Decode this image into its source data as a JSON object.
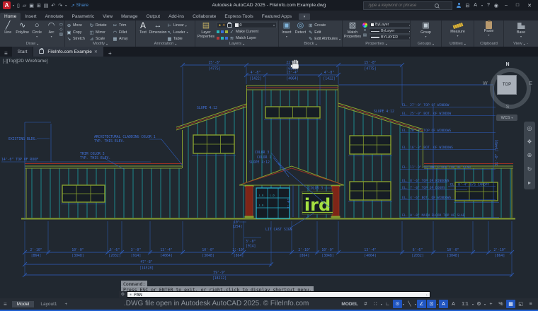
{
  "ui": {
    "caret": "▾",
    "close": "✕",
    "plus": "+",
    "hamburger": "≡",
    "min": "–",
    "max": "□",
    "collapse": "⌃",
    "slash": "╱"
  },
  "titlebar": {
    "logo": "A",
    "qat": [
      {
        "name": "new-icon",
        "glyph": "▯"
      },
      {
        "name": "open-icon",
        "glyph": "▱"
      },
      {
        "name": "save-icon",
        "glyph": "▣"
      },
      {
        "name": "saveas-icon",
        "glyph": "⊞"
      },
      {
        "name": "plot-icon",
        "glyph": "▤"
      },
      {
        "name": "undo-icon",
        "glyph": "↶"
      },
      {
        "name": "redo-icon",
        "glyph": "↷"
      }
    ],
    "share_icon": "↗",
    "share_label": "Share",
    "title": "Autodesk AutoCAD 2025 - FileInfo.com Example.dwg",
    "search_placeholder": "Type a keyword or phrase",
    "cart_icon": "⊟",
    "autodesk_icon": "A",
    "help_icon": "?",
    "account_icon": "◉"
  },
  "ribbon": {
    "tabs": [
      "Home",
      "Insert",
      "Annotate",
      "Parametric",
      "View",
      "Manage",
      "Output",
      "Add-ins",
      "Collaborate",
      "Express Tools",
      "Featured Apps"
    ],
    "draw": {
      "label": "Draw",
      "tools": [
        {
          "label": "Line",
          "glyph": "╱"
        },
        {
          "label": "Polyline",
          "glyph": "∿"
        },
        {
          "label": "Circle",
          "glyph": "○"
        },
        {
          "label": "Arc",
          "glyph": "◠"
        }
      ],
      "extras": [
        "▭",
        "◇",
        "▨"
      ]
    },
    "modify": {
      "label": "Modify",
      "tools": [
        {
          "label": "Move",
          "glyph": "⊕"
        },
        {
          "label": "Rotate",
          "glyph": "↻"
        },
        {
          "label": "Trim",
          "glyph": "✂"
        },
        {
          "label": "Copy",
          "glyph": "▣"
        },
        {
          "label": "Mirror",
          "glyph": "◫"
        },
        {
          "label": "Fillet",
          "glyph": "◠"
        },
        {
          "label": "Stretch",
          "glyph": "↘"
        },
        {
          "label": "Scale",
          "glyph": "⊿"
        },
        {
          "label": "Array",
          "glyph": "▦"
        }
      ]
    },
    "annotation": {
      "label": "Annotation",
      "big": [
        {
          "label": "Text",
          "glyph": "A"
        },
        {
          "label": "Dimension",
          "glyph": "↔"
        }
      ],
      "small": [
        {
          "label": "Linear",
          "glyph": "⊢"
        },
        {
          "label": "Leader",
          "glyph": "↖"
        },
        {
          "label": "Table",
          "glyph": "▦"
        }
      ]
    },
    "layers": {
      "label": "Layers",
      "big_label": "Layer Properties",
      "big_glyph": "▤",
      "bulb": "●",
      "sun": "☀",
      "layer_value": "0",
      "actions": [
        {
          "label": "Make Current",
          "glyph": "✓"
        },
        {
          "label": "Match Layer",
          "glyph": "≋"
        }
      ]
    },
    "block": {
      "label": "Block",
      "big": [
        {
          "label": "Insert",
          "glyph": "▣"
        },
        {
          "label": "Detect",
          "glyph": "◎"
        }
      ],
      "small": [
        {
          "label": "Create",
          "glyph": "⊞"
        },
        {
          "label": "Edit",
          "glyph": "✎"
        },
        {
          "label": "Edit Attributes",
          "glyph": "✎"
        }
      ]
    },
    "properties": {
      "label": "Properties",
      "big_label": "Match Properties",
      "big_glyph": "▧",
      "rows": [
        "ByLayer",
        "ByLayer",
        "BYLAYER"
      ],
      "minis": [
        "≡",
        "▤"
      ]
    },
    "groups": {
      "label": "Groups",
      "big_label": "Group",
      "glyph": "▣"
    },
    "utilities": {
      "label": "Utilities",
      "big_label": "Measure"
    },
    "clipboard": {
      "label": "Clipboard",
      "big_label": "Paste"
    },
    "view": {
      "label": "View",
      "big_label": "Base"
    }
  },
  "file_tabs": {
    "start": "Start",
    "active": "FileInfo.com Example"
  },
  "viewport": {
    "label": "[-][Top][2D Wireframe]",
    "viewcube": {
      "n": "N",
      "w": "W",
      "e": "E",
      "s": "S",
      "top": "TOP",
      "wcs": "WCS"
    }
  },
  "drawing": {
    "labels": {
      "existing_bldg": "EXISTING BLDG.",
      "top_of_roof": "14'-0\"  TOP OF ROOF",
      "cladding1": "ARCHITECTURAL CLADDING COLOR 1",
      "cladding2": "TYP. THIS ELEV.",
      "trim1": "TRIM COLOR 3",
      "trim2": "TYP. THIS ELEV.",
      "slope_left": "SLOPE 4:12",
      "slope_right": "SLOPE 4:12",
      "slope_canopy": "SLOPE 4:12",
      "canopy_color3": "COLOR 3",
      "canopy_color1": "COLOR 1",
      "sign_color3": "COLOR 3",
      "lit_cast_sign": "LIT CAST SIGN",
      "sign_text": "ird",
      "lo1": "L.O.",
      "lo2": "L.O.",
      "lo3": "L.O.",
      "dim10": "10\"",
      "dim10mm": "[254]",
      "dim3ft": "3'-0\"",
      "dim3ftmm": "[914]",
      "vdim_door": "7'-0\"",
      "vdim_right": "31'-0\" [9449]"
    },
    "elevations": [
      "EL. 27'-0\"  TOP OF WINDOW",
      "EL. 25'-0\"  BOT. OF WINDOW",
      "EL. 20'-3\"  TOP OF WINDOWS",
      "EL. 16'-3\"  BOT. OF WINDOWS",
      "EL. 11'-9\"  SECOND FLOOR TOP OF SLAB",
      "EL. 8'-6\"  TOP OF WINDOWS",
      "EL. 8'-4\"  U/S CANOPY",
      "EL. 7'-0\"  TOP OF DOORS",
      "EL. 4'-6\"  BOT. OF WINDOWS",
      "EL. 0'-0\"  MAIN FLOOR TOP OF SLAB"
    ],
    "dims_top": [
      {
        "ft": "15'-8\"",
        "mm": "[4775]"
      },
      {
        "ft": "22'-8\"",
        "mm": "[6909]"
      },
      {
        "ft": "15'-8\"",
        "mm": "[4775]"
      }
    ],
    "dims_mid": [
      {
        "ft": "4'-8\"",
        "mm": "[1422]"
      },
      {
        "ft": "13'-4\"",
        "mm": "[4064]"
      },
      {
        "ft": "4'-8\"",
        "mm": "[1422]"
      }
    ],
    "dims_bottom": [
      {
        "ft": "2'-10\"",
        "mm": "[864]"
      },
      {
        "ft": "10'-0\"",
        "mm": "[3048]"
      },
      {
        "ft": "6'-6\"",
        "mm": "[2032]"
      },
      {
        "ft": "3'-0\"",
        "mm": "[914]"
      },
      {
        "ft": "13'-4\"",
        "mm": "[4064]"
      },
      {
        "ft": "10'-0\"",
        "mm": "[3048]"
      },
      {
        "ft": "2'-10\"",
        "mm": "[864]"
      },
      {
        "ft": "2'-10\"",
        "mm": "[864]"
      },
      {
        "ft": "10'-0\"",
        "mm": "[3048]"
      },
      {
        "ft": "13'-4\"",
        "mm": "[4064]"
      },
      {
        "ft": "6'-6\"",
        "mm": "[2032]"
      },
      {
        "ft": "10'-0\"",
        "mm": "[3048]"
      },
      {
        "ft": "2'-10\"",
        "mm": "[864]"
      }
    ],
    "dim_total1": {
      "ft": "47'-8\"",
      "mm": "[14528]"
    },
    "dim_total2": {
      "ft": "59'-9\"",
      "mm": "[18212]"
    },
    "colors": {
      "siding": "#1aa7ab",
      "trim": "#87a02f",
      "roof_red": "#9e3224",
      "dims": "#4170d6",
      "sign_green": "#a4e040",
      "door_cyan": "#22b6d4"
    }
  },
  "command": {
    "prompt": "Command:",
    "message": "Press ESC or ENTER to exit, or right-click to display shortcut menu.",
    "input": "PAN"
  },
  "statusbar": {
    "model_tab": "Model",
    "layout_tab": "Layout1",
    "watermark": ".DWG file open in Autodesk AutoCAD 2025. © FileInfo.com",
    "mode_label": "MODEL",
    "icons": [
      {
        "name": "grid-icon",
        "glyph": "#"
      },
      {
        "name": "snap-icon",
        "glyph": "∷"
      },
      {
        "name": "ortho-icon",
        "glyph": "∟"
      },
      {
        "name": "polar-tracking-icon",
        "glyph": "⊙"
      },
      {
        "name": "isodraft-icon",
        "glyph": "╲"
      },
      {
        "name": "osnap-tracking-icon",
        "glyph": "∠"
      },
      {
        "name": "osnap-icon",
        "glyph": "⊡"
      },
      {
        "name": "annotation-visibility-icon",
        "glyph": "A"
      },
      {
        "name": "autoscale-icon",
        "glyph": "A"
      },
      {
        "name": "annotation-scale-icon",
        "glyph": "1:1"
      },
      {
        "name": "workspace-icon",
        "glyph": "⚙"
      },
      {
        "name": "annotation-monitor-icon",
        "glyph": "+"
      },
      {
        "name": "selection-cycling-icon",
        "glyph": "%"
      },
      {
        "name": "graphics-performance-icon",
        "glyph": "▦"
      },
      {
        "name": "clean-screen-icon",
        "glyph": "◱"
      },
      {
        "name": "customization-icon",
        "glyph": "≡"
      }
    ]
  }
}
